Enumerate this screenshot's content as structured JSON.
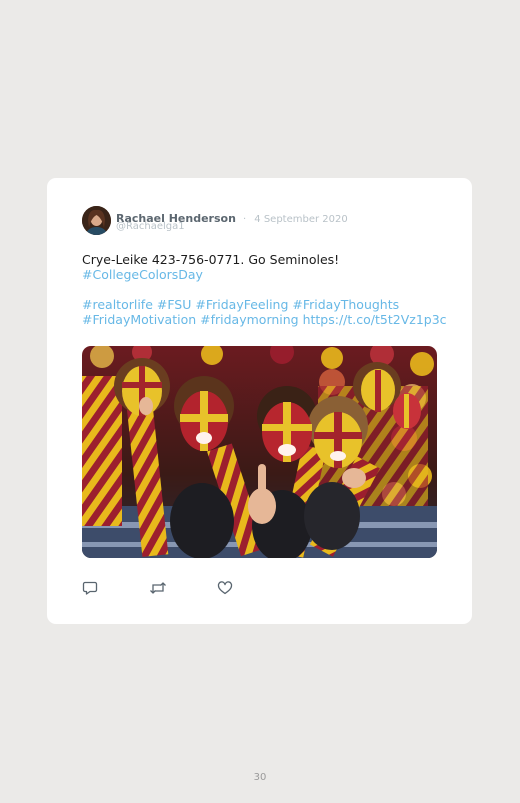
{
  "tweet": {
    "author_name": "Rachael Henderson",
    "separator": "·",
    "date": "4 September 2020",
    "handle": "@Rachaelga1",
    "text_line1": "Crye-Leike 423-756-0771. Go Seminoles!",
    "text_hashtag1": "#CollegeColorsDay",
    "tags_line1": "#realtorlife #FSU #FridayFeeling #FridayThoughts",
    "tags_line2": "#FridayMotivation #fridaymorning https://t.co/t5t2Vz1p3c"
  },
  "photo": {
    "description_icon": "photo-of-fans-with-garnet-and-gold-face-paint"
  },
  "actions": [
    {
      "icon": "reply-icon"
    },
    {
      "icon": "retweet-icon"
    },
    {
      "icon": "like-icon"
    }
  ],
  "page": {
    "number": "30"
  },
  "colors": {
    "background": "#ebeae8",
    "card": "#ffffff",
    "link": "#67b8e6",
    "garnet": "#9c1f2e",
    "gold": "#e8b91c"
  }
}
